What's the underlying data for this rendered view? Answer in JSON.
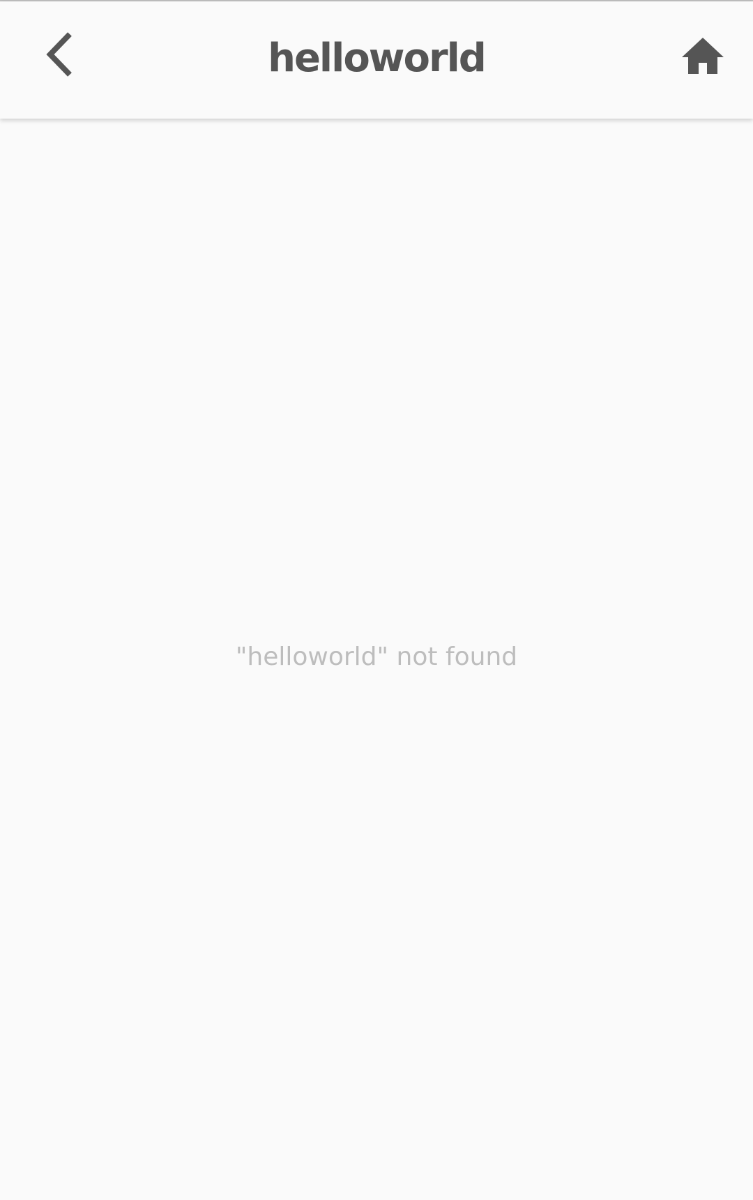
{
  "header": {
    "title": "helloworld",
    "back_icon": "chevron-left-icon",
    "home_icon": "home-icon"
  },
  "main": {
    "empty_message": "\"helloworld\" not found"
  },
  "colors": {
    "background": "#fafafa",
    "icon": "#555555",
    "title": "#555555",
    "muted_text": "#bdbdbd"
  }
}
